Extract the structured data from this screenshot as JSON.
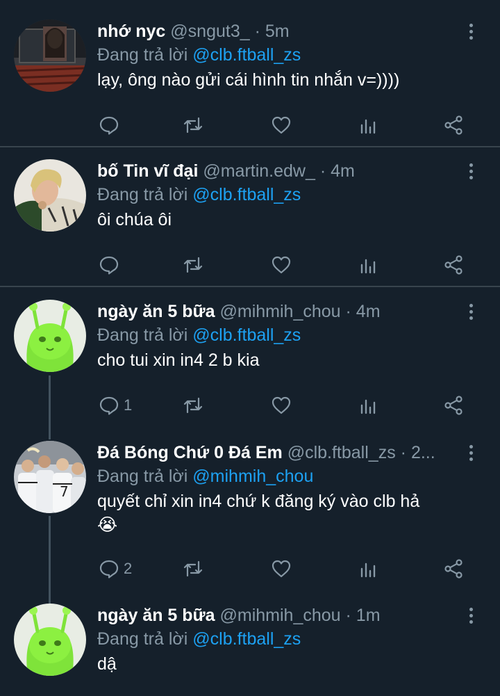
{
  "reply_prefix": "Đang trả lời",
  "colors": {
    "background": "#15202b",
    "link": "#1da1f2",
    "muted": "#8899a6",
    "divider": "#38444d"
  },
  "icons": {
    "reply": "speech-bubble-icon",
    "retweet": "retweet-arrows-icon",
    "like": "heart-icon",
    "analytics": "bar-chart-icon",
    "share": "share-nodes-icon",
    "more": "vertical-dots-icon"
  },
  "tweets": [
    {
      "name": "nhớ nyc",
      "handle": "@sngut3_",
      "separator": "·",
      "time": "5m",
      "reply_to": "@clb.ftball_zs",
      "text": "lạy, ông nào gửi cái hình tin nhắn v=))))",
      "reply_count": ""
    },
    {
      "name": "bố Tin vĩ đại",
      "handle": "@martin.edw_",
      "separator": "·",
      "time": "4m",
      "reply_to": "@clb.ftball_zs",
      "text": "ôi chúa ôi",
      "reply_count": ""
    },
    {
      "name": "ngày ăn 5 bữa",
      "handle": "@mihmih_chou",
      "separator": "·",
      "time": "4m",
      "reply_to": "@clb.ftball_zs",
      "text": "cho tui xin in4 2 b kia",
      "reply_count": "1"
    },
    {
      "name": "Đá Bóng Chứ 0 Đá Em",
      "handle": "@clb.ftball_zs",
      "separator": "·",
      "time": "2...",
      "reply_to": "@mihmih_chou",
      "text": "quyết chỉ xin in4 chứ k đăng ký vào clb hả",
      "emoji": "😭",
      "reply_count": "2"
    },
    {
      "name": "ngày ăn 5 bữa",
      "handle": "@mihmih_chou",
      "separator": "·",
      "time": "1m",
      "reply_to": "@clb.ftball_zs",
      "text": "dậ",
      "reply_count": ""
    }
  ]
}
